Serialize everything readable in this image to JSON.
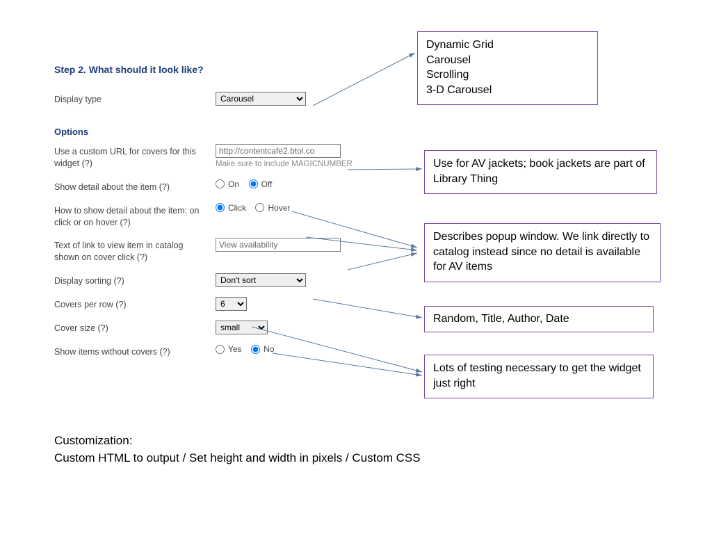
{
  "form": {
    "step_title": "Step 2. What should it look like?",
    "display_type": {
      "label": "Display type",
      "value": "Carousel"
    },
    "options_heading": "Options",
    "custom_url": {
      "label": "Use a custom URL for covers for this widget (?)",
      "value": "http://contentcafe2.btol.co",
      "hint": "Make sure to include MAGICNUMBER"
    },
    "show_detail": {
      "label": "Show detail about the item (?)",
      "on": "On",
      "off": "Off",
      "selected": "off"
    },
    "how_detail": {
      "label": "How to show detail about the item: on click or on hover (?)",
      "click": "Click",
      "hover": "Hover",
      "selected": "click"
    },
    "link_text": {
      "label": "Text of link to view item in catalog shown on cover click (?)",
      "value": "View availability"
    },
    "sort": {
      "label": "Display sorting (?)",
      "value": "Don't sort"
    },
    "per_row": {
      "label": "Covers per row (?)",
      "value": "6"
    },
    "cover_size": {
      "label": "Cover size (?)",
      "value": "small"
    },
    "no_cover": {
      "label": "Show items without covers (?)",
      "yes": "Yes",
      "no": "No",
      "selected": "no"
    }
  },
  "callouts": {
    "display_type": {
      "lines": [
        "Dynamic Grid",
        "Carousel",
        "Scrolling",
        "3-D Carousel"
      ]
    },
    "custom_url": {
      "text": "Use for AV jackets; book jackets are part of Library Thing"
    },
    "detail_popup": {
      "text": "Describes popup window.  We link directly to catalog instead since no detail is available for AV items"
    },
    "sort": {
      "text": "Random, Title, Author, Date"
    },
    "sizing": {
      "text": "Lots of testing necessary to get the widget just right"
    }
  },
  "footer": {
    "line1": "Customization:",
    "line2": "Custom HTML to output / Set height and width in pixels / Custom CSS"
  }
}
